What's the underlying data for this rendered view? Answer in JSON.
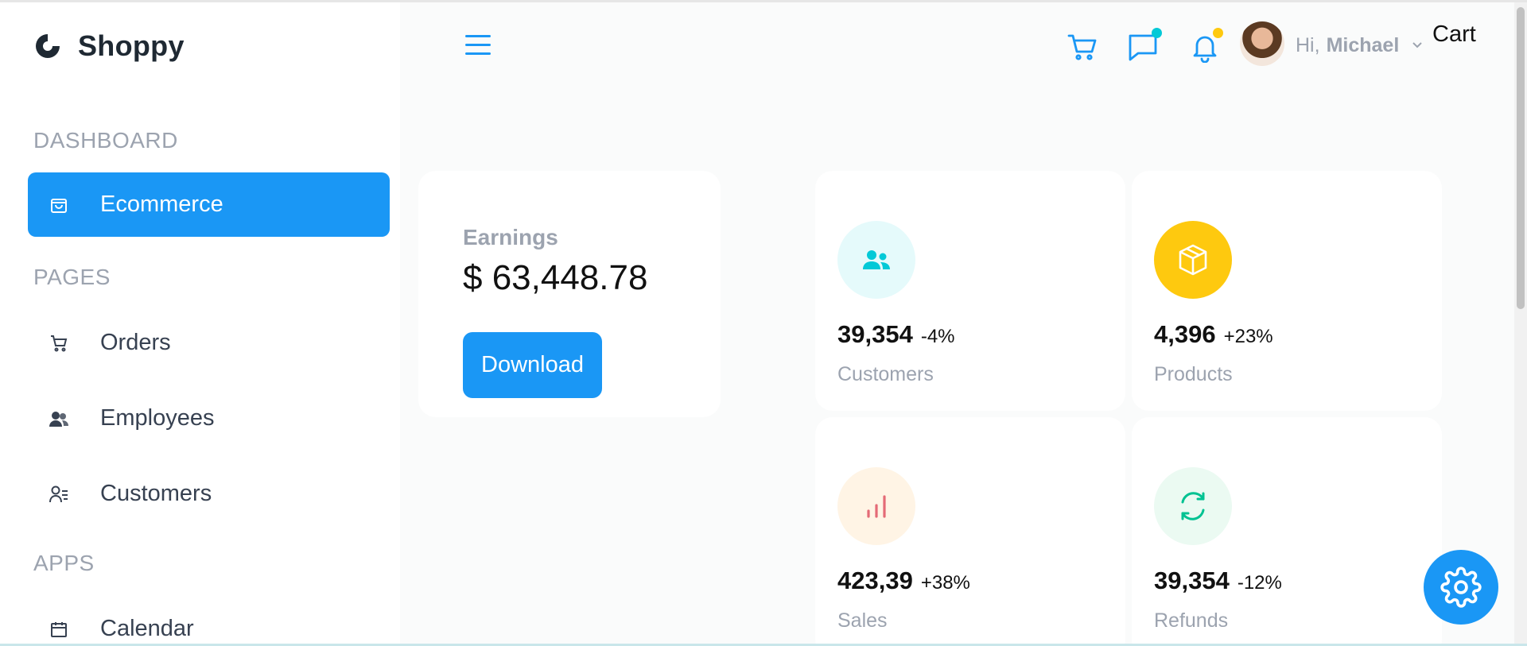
{
  "brand": {
    "name": "Shoppy"
  },
  "sidebar": {
    "sections": [
      {
        "title": "DASHBOARD",
        "items": [
          {
            "label": "Ecommerce",
            "icon": "shopping-bag-icon",
            "active": true
          }
        ]
      },
      {
        "title": "PAGES",
        "items": [
          {
            "label": "Orders",
            "icon": "cart-icon"
          },
          {
            "label": "Employees",
            "icon": "employees-icon"
          },
          {
            "label": "Customers",
            "icon": "customers-icon"
          }
        ]
      },
      {
        "title": "APPS",
        "items": [
          {
            "label": "Calendar",
            "icon": "calendar-icon"
          }
        ]
      }
    ]
  },
  "header": {
    "greeting_prefix": "Hi,",
    "user_name": "Michael",
    "cart_label": "Cart",
    "icons": [
      "menu-icon",
      "cart-icon",
      "chat-icon",
      "bell-icon"
    ],
    "chat_dot_color": "#03c9d7",
    "bell_dot_color": "#fec90f"
  },
  "earnings": {
    "title": "Earnings",
    "value": "$ 63,448.78",
    "button_label": "Download"
  },
  "stats": [
    {
      "value": "39,354",
      "change": "-4%",
      "label": "Customers",
      "icon": "users-icon",
      "icon_color": "#03c9d7",
      "bg_color": "#e5fafb"
    },
    {
      "value": "4,396",
      "change": "+23%",
      "label": "Products",
      "icon": "box-icon",
      "icon_color": "#ffffff",
      "bg_color": "#fec90f"
    },
    {
      "value": "423,39",
      "change": "+38%",
      "label": "Sales",
      "icon": "bar-chart-icon",
      "icon_color": "#e46a76",
      "bg_color": "#fff4e5"
    },
    {
      "value": "39,354",
      "change": "-12%",
      "label": "Refunds",
      "icon": "refresh-icon",
      "icon_color": "#00c292",
      "bg_color": "#ebfaf2"
    }
  ],
  "theme": {
    "accent": "#1a97f5"
  }
}
